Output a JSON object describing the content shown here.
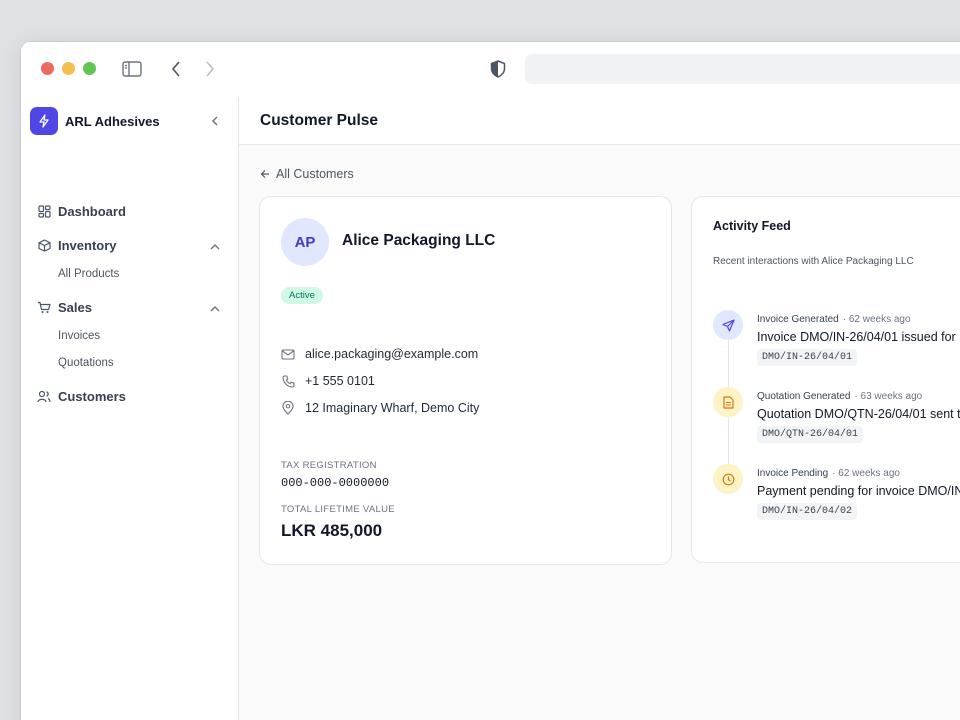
{
  "sidebar": {
    "brand": "ARL Adhesives",
    "items": [
      {
        "label": "Dashboard"
      },
      {
        "label": "Inventory",
        "children": [
          "All Products"
        ]
      },
      {
        "label": "Sales",
        "children": [
          "Invoices",
          "Quotations"
        ]
      },
      {
        "label": "Customers"
      }
    ]
  },
  "header": {
    "title": "Customer Pulse"
  },
  "back_link": "All Customers",
  "customer": {
    "initials": "AP",
    "name": "Alice Packaging LLC",
    "status": "Active",
    "email": "alice.packaging@example.com",
    "phone": "+1 555 0101",
    "address": "12 Imaginary Wharf, Demo City",
    "tax_label": "TAX REGISTRATION",
    "tax_value": "000-000-0000000",
    "ltv_label": "TOTAL LIFETIME VALUE",
    "ltv_value": "LKR 485,000"
  },
  "feed": {
    "title": "Activity Feed",
    "subtitle": "Recent interactions with Alice Packaging LLC",
    "items": [
      {
        "type": "Invoice Generated",
        "ago": "· 62 weeks ago",
        "desc": "Invoice DMO/IN-26/04/01 issued for",
        "code": "DMO/IN-26/04/01",
        "icon": "send-icon",
        "color": "#e0e7ff"
      },
      {
        "type": "Quotation Generated",
        "ago": "· 63 weeks ago",
        "desc": "Quotation DMO/QTN-26/04/01 sent t",
        "code": "DMO/QTN-26/04/01",
        "icon": "document-icon",
        "color": "#fef3c7"
      },
      {
        "type": "Invoice Pending",
        "ago": "· 62 weeks ago",
        "desc": "Payment pending for invoice DMO/IN",
        "code": "DMO/IN-26/04/02",
        "icon": "clock-icon",
        "color": "#fef3c7"
      }
    ]
  }
}
